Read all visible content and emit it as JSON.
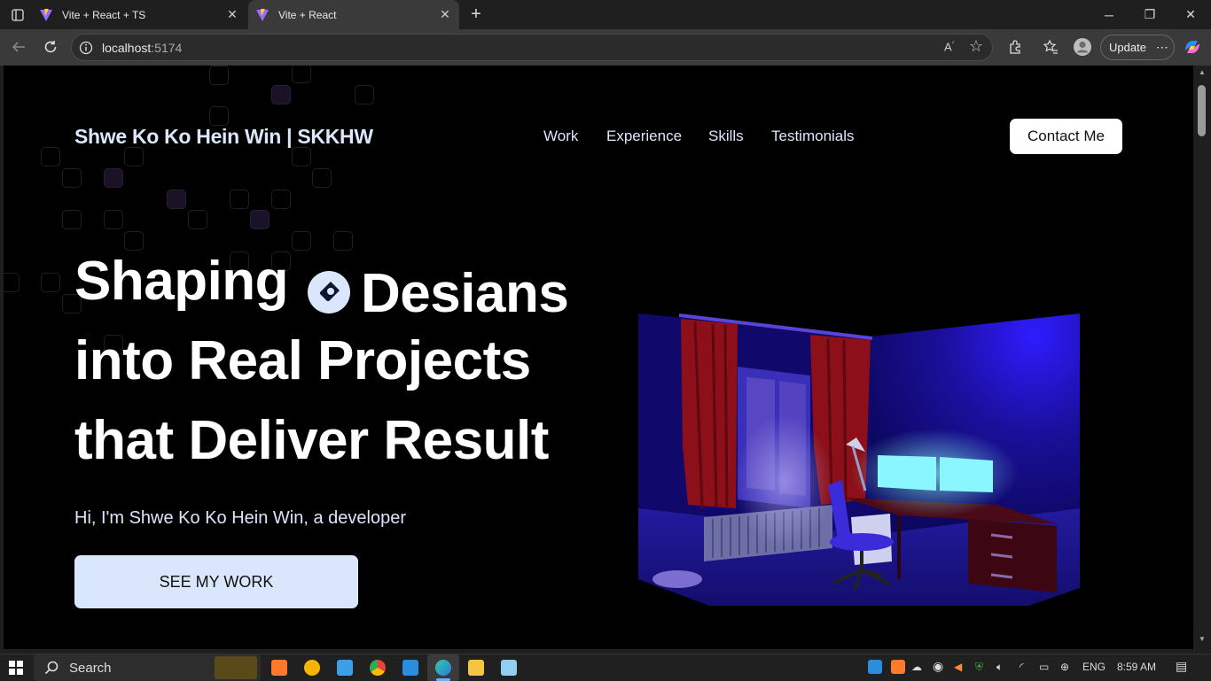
{
  "browser": {
    "tabs": [
      {
        "title": "Vite + React + TS",
        "active": false
      },
      {
        "title": "Vite + React",
        "active": true
      }
    ],
    "address": {
      "host": "localhost",
      "port": ":5174"
    },
    "update_label": "Update",
    "more_label": "⋯"
  },
  "site": {
    "brand": "Shwe Ko Ko Hein Win | SKKHW",
    "nav": [
      "Work",
      "Experience",
      "Skills",
      "Testimonials"
    ],
    "contact_label": "Contact Me",
    "hero": {
      "line1_a": "Shaping",
      "line1_b": "Desians",
      "line2": "into Real Projects",
      "line3": "that Deliver Result",
      "subtitle": "Hi, I'm Shwe Ko Ko Hein Win, a developer",
      "cta": "SEE MY WORK"
    }
  },
  "taskbar": {
    "search_label": "Search",
    "lang": "ENG",
    "time": "8:59 AM"
  },
  "colors": {
    "accent_light": "#d9e6fb",
    "room_blue": "#1c10a8",
    "curtain_red": "#8c0f1a",
    "monitor_cyan": "#8af6ff"
  }
}
